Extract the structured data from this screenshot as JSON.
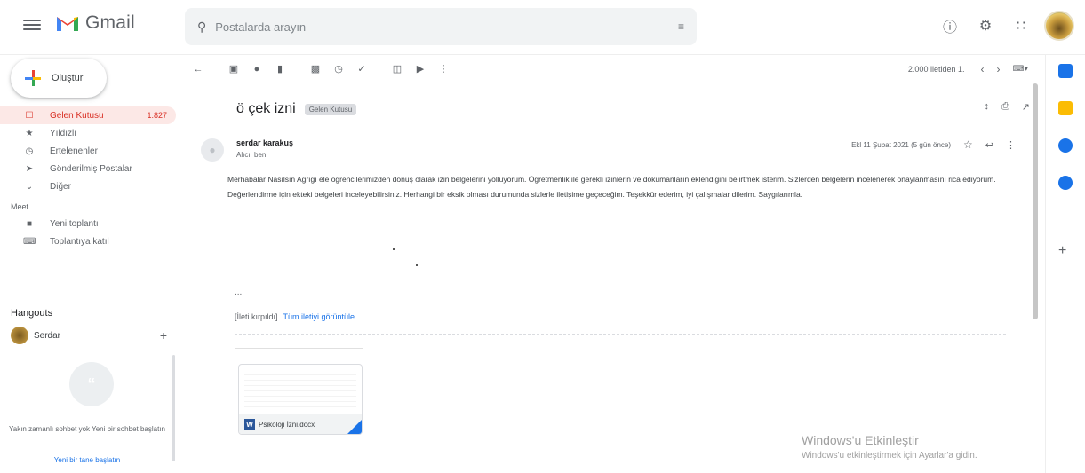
{
  "app": {
    "name": "Gmail"
  },
  "search": {
    "placeholder": "Postalarda arayın"
  },
  "compose": {
    "label": "Oluştur"
  },
  "nav": {
    "items": [
      {
        "label": "Gelen Kutusu",
        "count": "1.827",
        "icon": "inbox-icon"
      },
      {
        "label": "Yıldızlı",
        "icon": "star-icon"
      },
      {
        "label": "Ertelenenler",
        "icon": "clock-icon"
      },
      {
        "label": "Gönderilmiş Postalar",
        "icon": "send-icon"
      },
      {
        "label": "Diğer",
        "icon": "chevron-down-icon"
      }
    ]
  },
  "meet": {
    "label": "Meet",
    "items": [
      {
        "label": "Yeni toplantı",
        "icon": "video-icon"
      },
      {
        "label": "Toplantıya katıl",
        "icon": "keyboard-icon"
      }
    ]
  },
  "hangouts": {
    "label": "Hangouts",
    "user": "Serdar",
    "note": "Yakın zamanlı sohbet yok Yeni bir sohbet başlatın",
    "link": "Yeni bir tane başlatın"
  },
  "toolbar": {
    "pagination": "2.000 iletiden 1.",
    "lang": "tr"
  },
  "email": {
    "subject": "ö çek izni",
    "label_chip": "Gelen Kutusu",
    "sender": "serdar karakuş",
    "recipient": "Alıcı: ben",
    "date": "Ekl 11 Şubat 2021 (5 gün önce)",
    "body": "Merhabalar Nasılsın Ağrığı ele öğrencilerimizden dönüş olarak izin belgelerini yolluyorum. Öğretmenlik ile gerekli izinlerin ve dokümanların eklendiğini belirtmek isterim. Sizlerden belgelerin incelenerek onaylanmasını rica ediyorum. Değerlendirme için ekteki belgeleri inceleyebilirsiniz. Herhangi bir eksik olması durumunda sizlerle iletişime geçeceğim. Teşekkür ederim, iyi çalışmalar dilerim. Saygılarımla.",
    "ellipsis": "...",
    "link1": "[İleti kırpıldı]",
    "link2": "Tüm iletiyi görüntüle",
    "attachment": "Psikoloji İzni.docx"
  },
  "watermark": {
    "line1": "Windows'u Etkinleştir",
    "line2": "Windows'u etkinleştirmek için Ayarlar'a gidin."
  },
  "colors": {
    "accent_red": "#d93025",
    "link_blue": "#1a73e8"
  }
}
